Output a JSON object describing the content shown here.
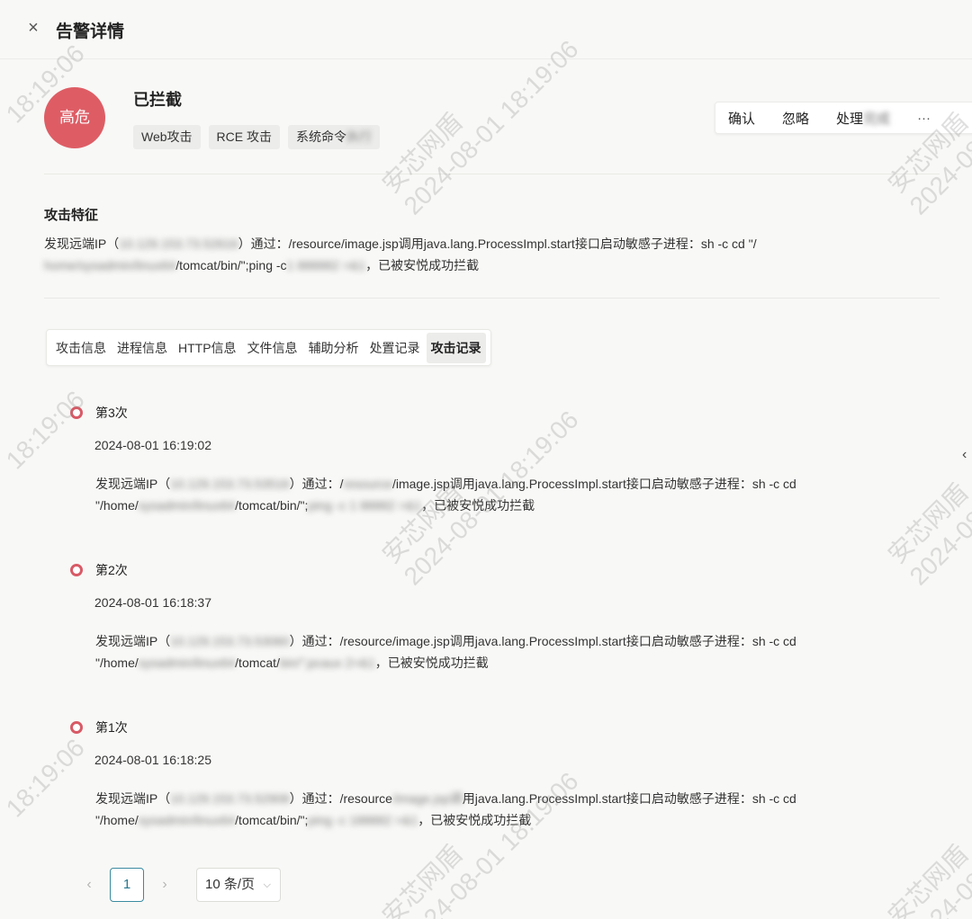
{
  "header": {
    "title": "告警详情",
    "close_icon": "close-icon"
  },
  "summary": {
    "level": "高危",
    "level_color": "#de5d65",
    "status": "已拦截",
    "tags": [
      {
        "text": "Web攻击",
        "tail": ""
      },
      {
        "text": "RCE 攻击",
        "tail": ""
      },
      {
        "text": "系统命令",
        "tail": "执行"
      }
    ]
  },
  "actions": {
    "confirm": "确认",
    "ignore": "忽略",
    "handle": "处理",
    "handle_tail": "完成",
    "more": "···"
  },
  "feature": {
    "title": "攻击特征",
    "prefix": "发现远端IP（",
    "ip": "10.129.153.73.52616",
    "mid": "）通过：/resource/image.jsp调用java.lang.ProcessImpl.start接口启动敏感子进程：sh -c cd \"/",
    "path_redacted": "home/sysadmin/linux64",
    "path_tail": "/tomcat/bin/\";ping -c",
    "cmd_redacted": " 1 888882 >&1",
    "suffix": "，已被安悦成功拦截"
  },
  "tabs": [
    "攻击信息",
    "进程信息",
    "HTTP信息",
    "文件信息",
    "辅助分析",
    "处置记录",
    "攻击记录"
  ],
  "active_tab": "攻击记录",
  "records": [
    {
      "label": "第3次",
      "time": "2024-08-01 16:19:02",
      "prefix": "发现远端IP（",
      "ip": "10.129.153.73.53516",
      "mid_a": "）通过：/",
      "mid_redacted": "resource",
      "mid_b": "/image.jsp调用java.lang.ProcessImpl.start接口启动敏感子进程：sh -c cd \"/home/",
      "path_redacted": "sysadmin/linux64",
      "path_tail": "/tomcat/bin/\";",
      "cmd_redacted": "ping -c 1 88882 >&1",
      "suffix": "，已被安悦成功拦截"
    },
    {
      "label": "第2次",
      "time": "2024-08-01 16:18:37",
      "prefix": "发现远端IP（",
      "ip": "10.129.153.73.53060",
      "mid_a": "）通过：/resource/image.jsp调用java.lang.ProcessImpl.start接口启动敏感子进程：sh -c cd \"/home/",
      "mid_redacted": "",
      "mid_b": "",
      "path_redacted": "sysadmin/linux64",
      "path_tail": "/tomcat/",
      "cmd_redacted": "bin/\";pcaux 2>&1",
      "suffix": "，已被安悦成功拦截"
    },
    {
      "label": "第1次",
      "time": "2024-08-01 16:18:25",
      "prefix": "发现远端IP（",
      "ip": "10.129.153.73.52908",
      "mid_a": "）通过：/resource",
      "mid_redacted": "/image.jsp调",
      "mid_b": "用java.lang.ProcessImpl.start接口启动敏感子进程：sh -c cd \"/home/",
      "path_redacted": "sysadmin/linux64",
      "path_tail": "/tomcat/bin/\";",
      "cmd_redacted": "ping -c 188882 >&1",
      "suffix": "，已被安悦成功拦截"
    }
  ],
  "pagination": {
    "prev": "‹",
    "current": "1",
    "next": "›",
    "page_size": "10 条/页",
    "caret": "⌵"
  },
  "edge_chevron": "‹",
  "watermark": {
    "text1": "安芯网盾",
    "text2": "2024-08-01 18:19:06",
    "text3": "18:19:06"
  }
}
